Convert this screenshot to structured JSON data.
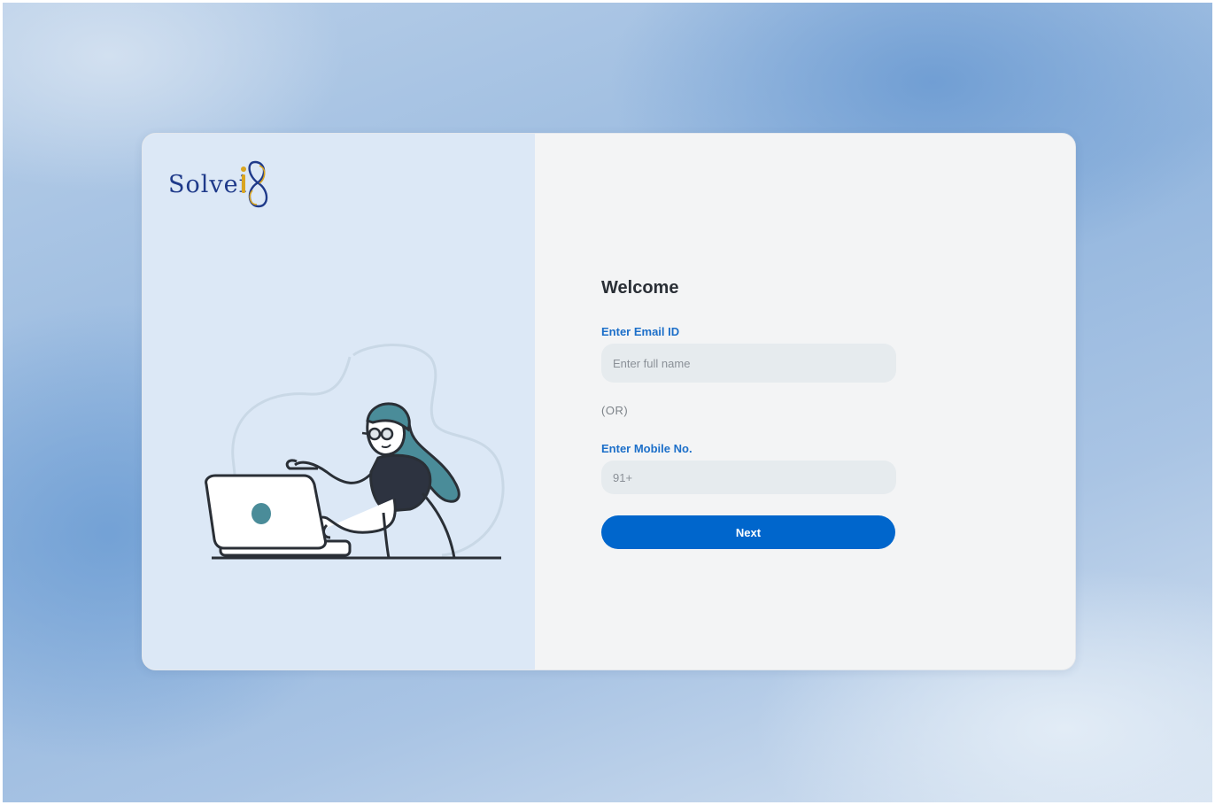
{
  "brand": {
    "logo_text": "Solvei",
    "logo_mark": "8",
    "colors": {
      "navy": "#1f3a8a",
      "gold": "#d9a520"
    }
  },
  "illustration": {
    "icon": "person-at-laptop-illustration"
  },
  "form": {
    "title": "Welcome",
    "email_label": "Enter Email ID",
    "email_placeholder": "Enter full name",
    "email_value": "",
    "or_text": "(OR)",
    "mobile_label": "Enter Mobile No.",
    "mobile_placeholder": "91+",
    "mobile_value": "",
    "next_label": "Next"
  },
  "colors": {
    "accent": "#0066cc",
    "label": "#1c6fc9",
    "left_panel": "#dce8f6",
    "right_panel": "#f3f4f5"
  }
}
